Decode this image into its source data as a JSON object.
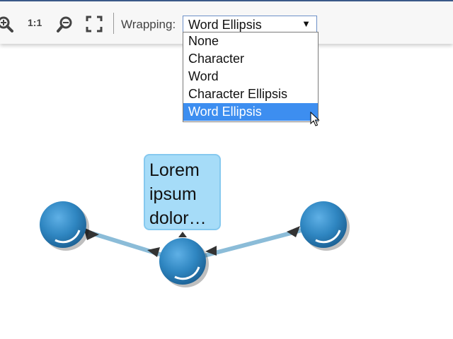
{
  "toolbar": {
    "zoom_in_icon": "zoom-in-icon",
    "reset_zoom_label": "1:1",
    "zoom_out_icon": "zoom-out-icon",
    "fit_icon": "fit-to-screen-icon",
    "wrapping_label": "Wrapping:",
    "wrapping_selected": "Word Ellipsis",
    "wrapping_options": [
      "None",
      "Character",
      "Word",
      "Character Ellipsis",
      "Word Ellipsis"
    ]
  },
  "graph": {
    "label_lines": [
      "Lorem",
      "ipsum",
      "dolor…"
    ],
    "node_color": "#2f86c1",
    "edge_color": "#8bbcd8",
    "label_fill": "#a6dcf8"
  }
}
